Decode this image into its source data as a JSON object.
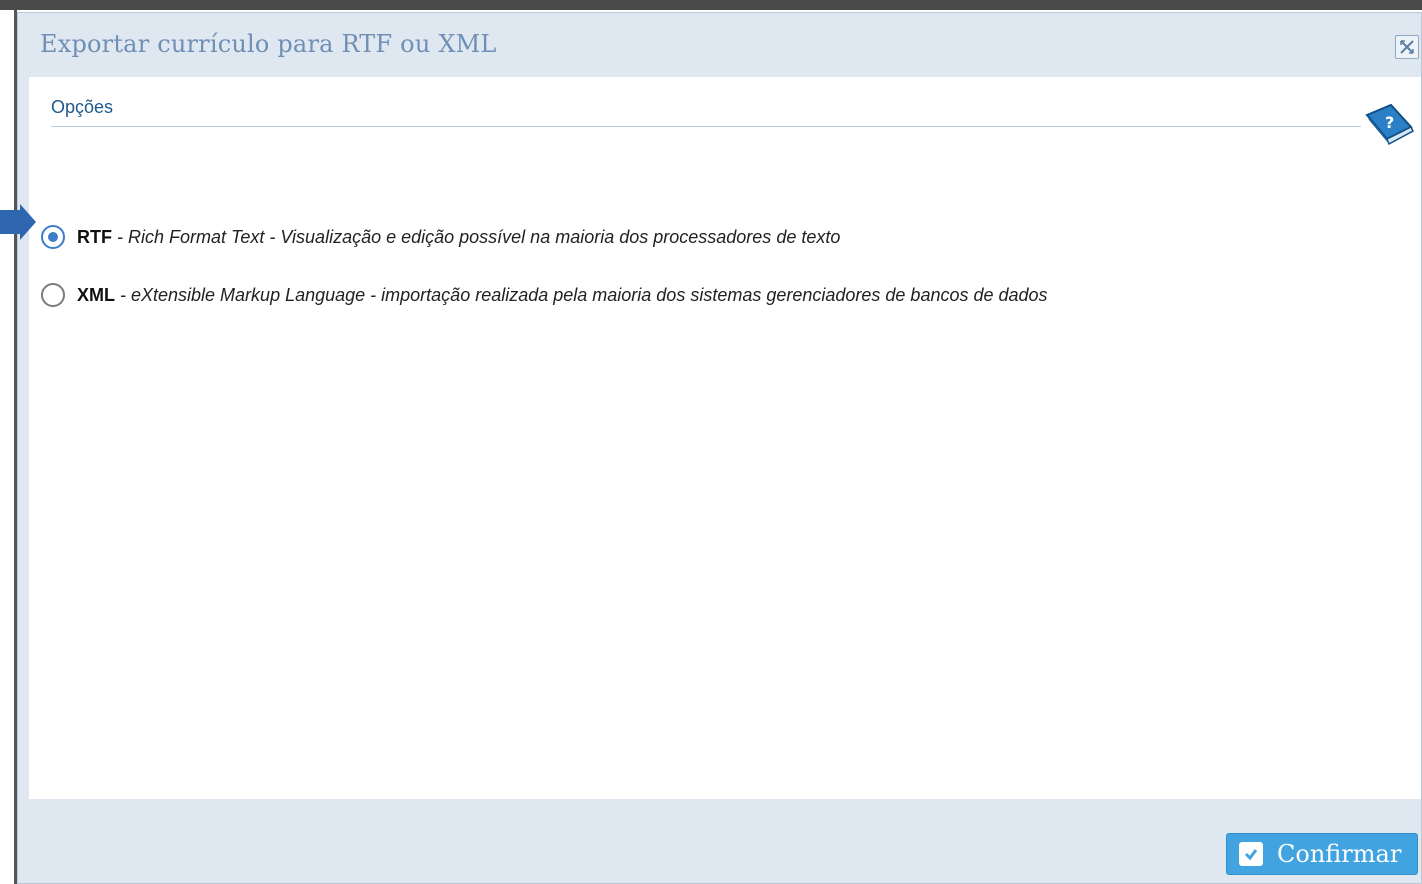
{
  "dialog": {
    "title": "Exportar currículo para RTF ou XML"
  },
  "section": {
    "title": "Opções"
  },
  "options": [
    {
      "code": "RTF",
      "description": " - Rich Format Text - Visualização e edição possível na maioria dos processadores de texto",
      "selected": true
    },
    {
      "code": "XML",
      "description": " - eXtensible Markup Language - importação realizada pela maioria dos sistemas gerenciadores de bancos de dados",
      "selected": false
    }
  ],
  "footer": {
    "confirm_label": "Confirmar"
  },
  "icons": {
    "close": "close-icon",
    "help": "help-book-icon",
    "confirm": "check-icon",
    "pointer": "arrow-pointer-icon"
  },
  "colors": {
    "accent": "#3d7cc9",
    "button": "#41a3e0",
    "title_text": "#6f8fb5",
    "section_text": "#1f5a8f",
    "dialog_bg": "#dfe8f1"
  }
}
